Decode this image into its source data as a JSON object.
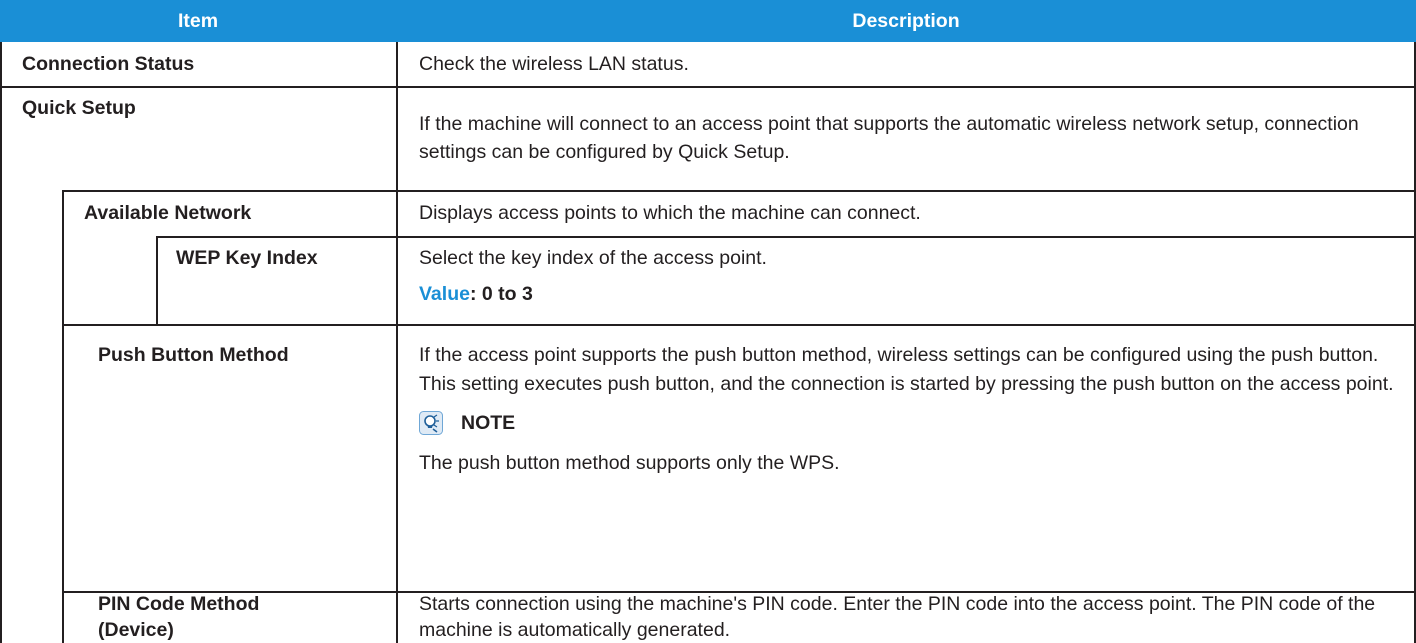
{
  "table": {
    "headers": {
      "item": "Item",
      "description": "Description"
    },
    "rows": {
      "connection_status": {
        "item": "Connection Status",
        "description": "Check the wireless LAN status."
      },
      "quick_setup": {
        "item": "Quick Setup",
        "description": "If the machine will connect to an access point that supports the automatic wireless network setup, connection settings can be configured by Quick Setup."
      },
      "available_network": {
        "item": "Available Network",
        "description": "Displays access points to which the machine can connect."
      },
      "wep_key_index": {
        "item": "WEP Key Index",
        "description": "Select the key index of the access point.",
        "value_label": "Value",
        "value": ": 0 to 3"
      },
      "push_button_method": {
        "item": "Push Button Method",
        "description": "If the access point supports the push button method, wireless settings can be configured using the push button. This setting executes push button, and the connection is started by pressing the push button on the access point.",
        "note_title": "NOTE",
        "note_icon": "note-lightbulb-icon",
        "note_text": "The push button method supports only the WPS."
      },
      "pin_code_device": {
        "item_line1": "PIN Code Method",
        "item_line2": "(Device)",
        "description": "Starts connection using the machine's PIN code. Enter the PIN code into the access point. The PIN code of the machine is automatically generated."
      }
    }
  },
  "colors": {
    "header_bg": "#1a8fd6",
    "accent": "#1a8fd6",
    "text": "#231f20",
    "rule": "#231f20"
  }
}
